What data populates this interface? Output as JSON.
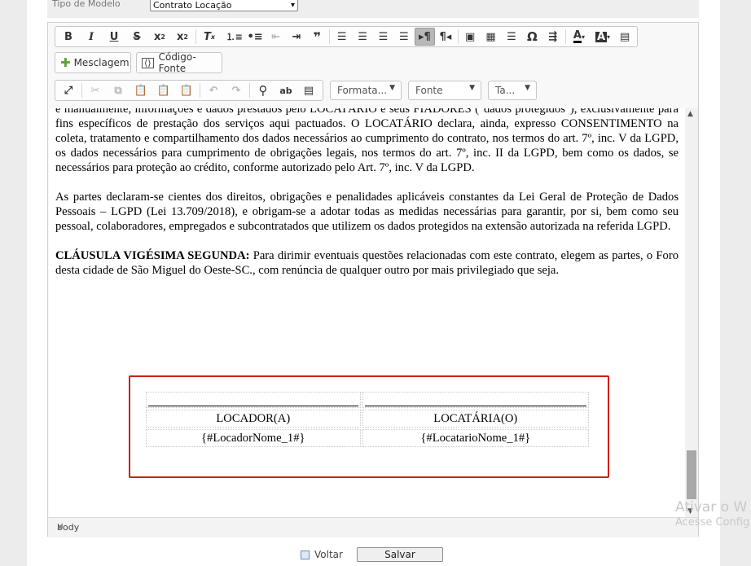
{
  "form": {
    "model_label": "Tipo de Modelo",
    "model_value": "Contrato Locação"
  },
  "toolbar": {
    "mesclagem_label": "Mesclagem",
    "source_label": "Código-Fonte",
    "format_combo": "Formata...",
    "font_combo": "Fonte",
    "size_combo": "Ta..."
  },
  "document": {
    "p1": "e manualmente, informações e dados prestados pelo LOCATÁRIO e seus FIADORES (\"dados protegidos\"), exclusivamente para fins específicos de prestação dos serviços aqui pactuados. O LOCATÁRIO declara, ainda, expresso CONSENTIMENTO na coleta, tratamento e compartilhamento dos dados necessários ao cumprimento do contrato, nos termos do art. 7º, inc. V da LGPD, os dados necessários para cumprimento de obrigações legais, nos termos do art. 7º, inc. II da LGPD, bem como os dados, se necessários para proteção ao crédito, conforme autorizado pelo Art. 7º, inc. V da LGPD.",
    "p2": "As partes declaram-se cientes dos direitos, obrigações e penalidades aplicáveis constantes da Lei Geral de Proteção de Dados Pessoais – LGPD (Lei 13.709/2018), e obrigam-se a adotar todas as medidas necessárias para garantir, por si, bem como seu pessoal, colaboradores, empregados e subcontratados que utilizem os dados protegidos na extensão autorizada na referida LGPD.",
    "p3_heading": "CLÁUSULA VIGÉSIMA SEGUNDA:",
    "p3_body": " Para dirimir eventuais questões relacionadas com este contrato, elegem as partes, o Foro desta cidade de São Miguel do Oeste-SC., com renúncia de qualquer outro por mais privilegiado que seja.",
    "signatures": {
      "left_role": "LOCADOR(A)",
      "left_name": "{#LocadorNome_1#}",
      "right_role": "LOCATÁRIA(O)",
      "right_name": "{#LocatarioNome_1#}"
    }
  },
  "status_bar": "body",
  "footer": {
    "voltar": "Voltar",
    "salvar": "Salvar"
  },
  "watermark": {
    "line1": "Ativar o W",
    "line2": "Acesse Config"
  },
  "colors": {
    "highlight_border": "#cf1d1d",
    "toolbar_active": "#b8b8b8"
  }
}
